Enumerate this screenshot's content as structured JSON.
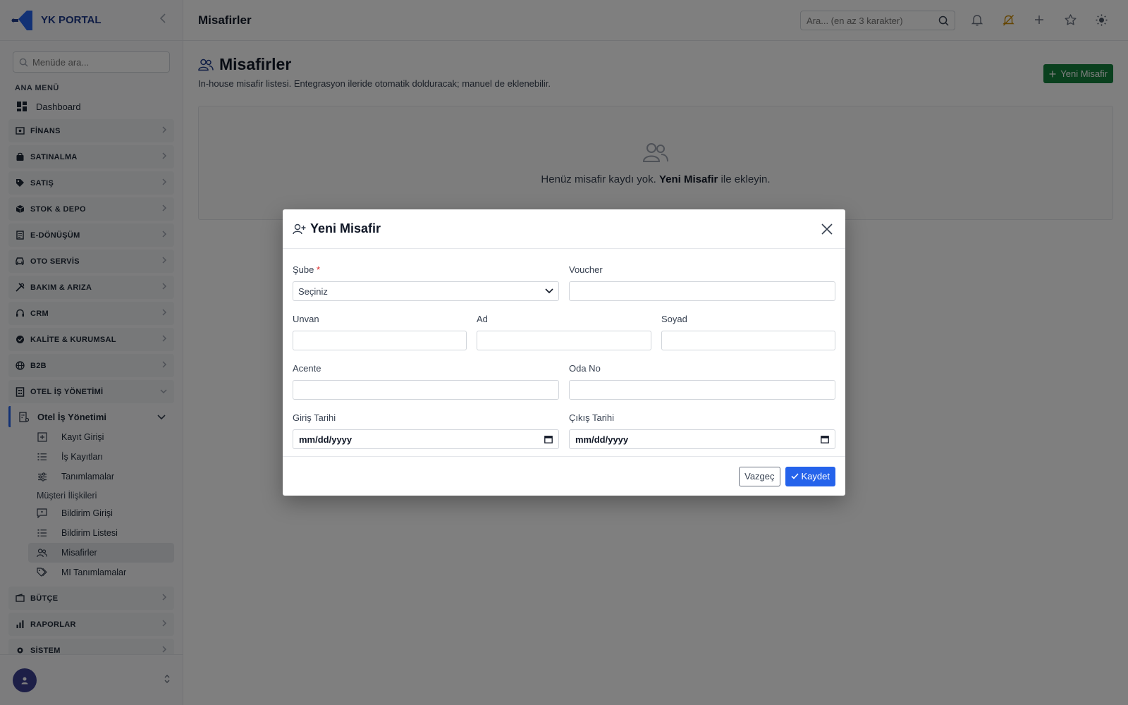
{
  "brand": {
    "name": "YK PORTAL"
  },
  "sidebar": {
    "search_placeholder": "Menüde ara...",
    "section_label": "ANA MENÜ",
    "dashboard": "Dashboard",
    "groups_top": [
      {
        "label": "FİNANS",
        "icon": "finance-icon"
      },
      {
        "label": "SATINALMA",
        "icon": "bag-icon"
      },
      {
        "label": "SATIŞ",
        "icon": "tag-icon"
      },
      {
        "label": "STOK & DEPO",
        "icon": "box-icon"
      },
      {
        "label": "E-DÖNÜŞÜM",
        "icon": "document-icon"
      },
      {
        "label": "OTO SERVİS",
        "icon": "car-icon"
      },
      {
        "label": "BAKIM & ARIZA",
        "icon": "tools-icon"
      },
      {
        "label": "CRM",
        "icon": "headset-icon"
      },
      {
        "label": "KALİTE & KURUMSAL",
        "icon": "badge-icon"
      },
      {
        "label": "B2B",
        "icon": "globe-icon"
      }
    ],
    "expanded_group": {
      "label": "OTEL İŞ YÖNETİMİ",
      "icon": "building-icon"
    },
    "active_sub": "Otel İş Yönetimi",
    "sub_items_1": [
      {
        "label": "Kayıt Girişi",
        "icon": "plus-square-icon"
      },
      {
        "label": "İş Kayıtları",
        "icon": "list-icon"
      },
      {
        "label": "Tanımlamalar",
        "icon": "sliders-icon"
      }
    ],
    "sub_heading": "Müşteri İlişkileri",
    "sub_items_2": [
      {
        "label": "Bildirim Girişi",
        "icon": "message-icon"
      },
      {
        "label": "Bildirim Listesi",
        "icon": "list-icon"
      },
      {
        "label": "Misafirler",
        "icon": "users-icon",
        "active": true
      },
      {
        "label": "MI Tanımlamalar",
        "icon": "tags-icon"
      }
    ],
    "groups_bottom": [
      {
        "label": "BÜTÇE",
        "icon": "wallet-icon"
      },
      {
        "label": "RAPORLAR",
        "icon": "bar-chart-icon"
      },
      {
        "label": "SİSTEM",
        "icon": "gear-icon"
      }
    ]
  },
  "topbar": {
    "title": "Misafirler",
    "search_placeholder": "Ara... (en az 3 karakter)"
  },
  "page": {
    "title": "Misafirler",
    "subtitle": "In-house misafir listesi. Entegrasyon ileride otomatik dolduracak; manuel de eklenebilir.",
    "new_button": "Yeni Misafir",
    "empty_prefix": "Henüz misafir kaydı yok.",
    "empty_bold": "Yeni Misafir",
    "empty_suffix": "ile ekleyin."
  },
  "modal": {
    "title": "Yeni Misafir",
    "fields": {
      "sube_label": "Şube",
      "sube_required": "*",
      "sube_value": "Seçiniz",
      "voucher_label": "Voucher",
      "unvan_label": "Unvan",
      "ad_label": "Ad",
      "soyad_label": "Soyad",
      "acente_label": "Acente",
      "oda_label": "Oda No",
      "giris_label": "Giriş Tarihi",
      "giris_value": "mm/dd/yyyy",
      "cikis_label": "Çıkış Tarihi",
      "cikis_value": "mm/dd/yyyy"
    },
    "cancel": "Vazgeç",
    "save": "Kaydet"
  },
  "colors": {
    "primary": "#2563eb",
    "success": "#15803d",
    "brand": "#1e3a8a",
    "danger": "#dc2626"
  }
}
